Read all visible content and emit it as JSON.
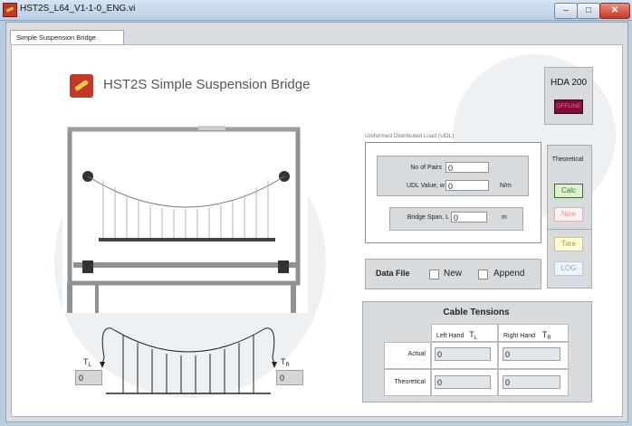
{
  "window": {
    "title": "HST2S_L64_V1-1-0_ENG.vi"
  },
  "tab": {
    "label": "Simple Suspension Bridge"
  },
  "header": {
    "title": "HST2S  Simple Suspension Bridge"
  },
  "device": {
    "name": "HDA 200",
    "status": "OFFLINE"
  },
  "controls": {
    "theoretical_label": "Theoretical",
    "calc": "Calc",
    "new": "New",
    "tare": "Tare",
    "log": "LOG"
  },
  "udl": {
    "caption": "Uniformed Distributed Load (UDL)",
    "pairs_label": "No of Pairs",
    "pairs_value": "0",
    "udl_label": "UDL Value, w",
    "udl_value": "0",
    "udl_unit": "N/m",
    "span_label": "Bridge Span, L",
    "span_value": "0",
    "span_unit": "m"
  },
  "data_file": {
    "label": "Data File",
    "new_label": "New",
    "append_label": "Append"
  },
  "cable_tensions": {
    "title": "Cable Tensions",
    "left_header": "Left Hand",
    "right_header": "Right Hand",
    "left_symbol": "T",
    "left_sub": "L",
    "right_symbol": "T",
    "right_sub": "R",
    "actual_label": "Actual",
    "theoretical_label": "Theoretical",
    "actual_left": "0",
    "actual_right": "0",
    "theoretical_left": "0",
    "theoretical_right": "0"
  },
  "diagram": {
    "tl_symbol": "T",
    "tl_sub": "L",
    "tr_symbol": "T",
    "tr_sub": "R",
    "tl_value": "0",
    "tr_value": "0"
  }
}
